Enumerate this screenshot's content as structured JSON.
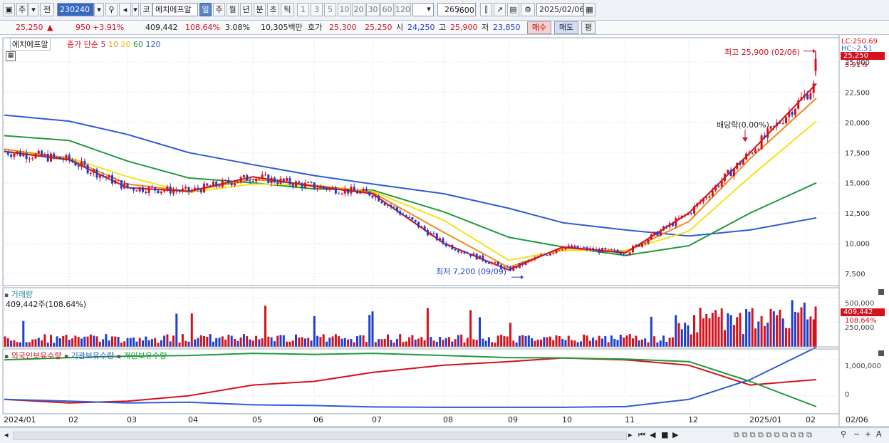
{
  "toolbar": {
    "market_code": "주",
    "market_type": "전",
    "stock_code": "230240",
    "stock_name_btn": "코",
    "stock_name": "에치에프알",
    "period_buttons": [
      "일",
      "주",
      "월",
      "년",
      "분",
      "초",
      "틱"
    ],
    "interval_buttons": [
      "1",
      "3",
      "5",
      "10",
      "20",
      "30",
      "60",
      "120"
    ],
    "count_display": "265",
    "count_total": "/600",
    "date": "2025/02/06"
  },
  "price_info": {
    "price": "25,250",
    "up_arrow": "▲",
    "change": "950",
    "change_pct": "+3.91%",
    "volume": "409,442",
    "volume_ratio": "108.64%",
    "turnover": "3.08%",
    "amount": "10,305백만",
    "bid_label": "호가",
    "ask_price": "25,300",
    "bid_price": "25,250",
    "open_label": "시",
    "open": "24,250",
    "high_label": "고",
    "high": "25,900",
    "low_label": "저",
    "low": "23,850",
    "buy_btn": "매수",
    "sell_btn": "매도",
    "eval_btn": "평"
  },
  "price_panel": {
    "title": "에치에프알",
    "ma_legend": [
      {
        "label": "종가 단순 5",
        "color": "#d4111d"
      },
      {
        "label": "10",
        "color": "#f08a1c"
      },
      {
        "label": "20",
        "color": "#f4e21a"
      },
      {
        "label": "60",
        "color": "#1f9a3a"
      },
      {
        "label": "120",
        "color": "#2f5bd7"
      }
    ],
    "axis_lc": "LC:250.69",
    "axis_hc": "HC:-2.51",
    "current_price_tag": "25,250",
    "current_pct": "3.91%",
    "high_annotation": "최고 25,900 (02/06)",
    "low_annotation": "최저 7,200 (09/09)",
    "dividend_annotation": "배당락(0.00%)"
  },
  "volume_panel": {
    "title": "거래량",
    "summary": "409,442주(108.64%)",
    "tag_value": "409,442",
    "tag_pct": "108.64%",
    "axis_top": "500,000",
    "axis_low": "250,000"
  },
  "holdings_panel": {
    "legend": [
      {
        "label": "외국인보유수량",
        "color": "#d4111d"
      },
      {
        "label": "기관보유수량",
        "color": "#2f5bd7"
      },
      {
        "label": "개인보유수량",
        "color": "#1f9a3a"
      }
    ],
    "axis_top": "1,000,000",
    "axis_zero": "0"
  },
  "time_axis": {
    "labels": [
      "2024/01",
      "02",
      "03",
      "04",
      "05",
      "06",
      "07",
      "08",
      "09",
      "10",
      "11",
      "12",
      "2025/01",
      "02"
    ],
    "right_label": "02/06"
  },
  "chart_data": [
    {
      "type": "line",
      "title": "에치에프알",
      "ylim": [
        6500,
        27000
      ],
      "yticks": [
        7500,
        10000,
        12500,
        15000,
        17500,
        20000,
        22500,
        25000
      ],
      "x": [
        "2024/01",
        "02",
        "03",
        "04",
        "05",
        "06",
        "07",
        "08",
        "09",
        "10",
        "11",
        "12",
        "2025/01",
        "02"
      ],
      "series": [
        {
          "name": "5",
          "values": [
            17600,
            16900,
            14600,
            14300,
            15500,
            14700,
            14100,
            10000,
            7800,
            9700,
            9200,
            12500,
            17500,
            23200
          ]
        },
        {
          "name": "10",
          "values": [
            17800,
            17000,
            14900,
            14300,
            15300,
            14800,
            14200,
            10900,
            8000,
            9600,
            9300,
            11800,
            17000,
            22000
          ]
        },
        {
          "name": "20",
          "values": [
            17600,
            17100,
            15500,
            14200,
            14900,
            14800,
            14300,
            11900,
            8600,
            9400,
            9400,
            11000,
            15500,
            20100
          ]
        },
        {
          "name": "60",
          "values": [
            18900,
            18500,
            16800,
            15400,
            15000,
            14500,
            14400,
            12600,
            10500,
            9700,
            9000,
            9800,
            12500,
            15000
          ]
        },
        {
          "name": "120",
          "values": [
            20600,
            20100,
            19000,
            17500,
            16500,
            15600,
            14900,
            14100,
            12900,
            11700,
            11100,
            10600,
            11100,
            12100
          ]
        }
      ],
      "high": {
        "value": 25900,
        "date": "02/06"
      },
      "low": {
        "value": 7200,
        "date": "09/09"
      },
      "last": 25250
    },
    {
      "type": "bar",
      "title": "거래량",
      "ylim": [
        0,
        600000
      ],
      "last": 409442
    },
    {
      "type": "line",
      "title": "보유수량",
      "ylim": [
        -500000,
        1300000
      ],
      "series": [
        {
          "name": "외국인보유수량",
          "values": [
            -100000,
            -200000,
            -150000,
            0,
            300000,
            400000,
            650000,
            850000,
            950000,
            1050000,
            1000000,
            850000,
            300000,
            450000
          ]
        },
        {
          "name": "기관보유수량",
          "values": [
            -100000,
            -150000,
            -200000,
            -180000,
            -250000,
            -270000,
            -310000,
            -320000,
            -320000,
            -320000,
            -300000,
            -100000,
            450000,
            1350000
          ]
        },
        {
          "name": "개인보유수량",
          "values": [
            1000000,
            1060000,
            1100000,
            1120000,
            1180000,
            1150000,
            1180000,
            1120000,
            1060000,
            1050000,
            1020000,
            950000,
            400000,
            -300000
          ]
        }
      ]
    }
  ],
  "colors": {
    "up": "#d4111d",
    "down": "#1d3fd0",
    "grid": "#d8dde6"
  }
}
